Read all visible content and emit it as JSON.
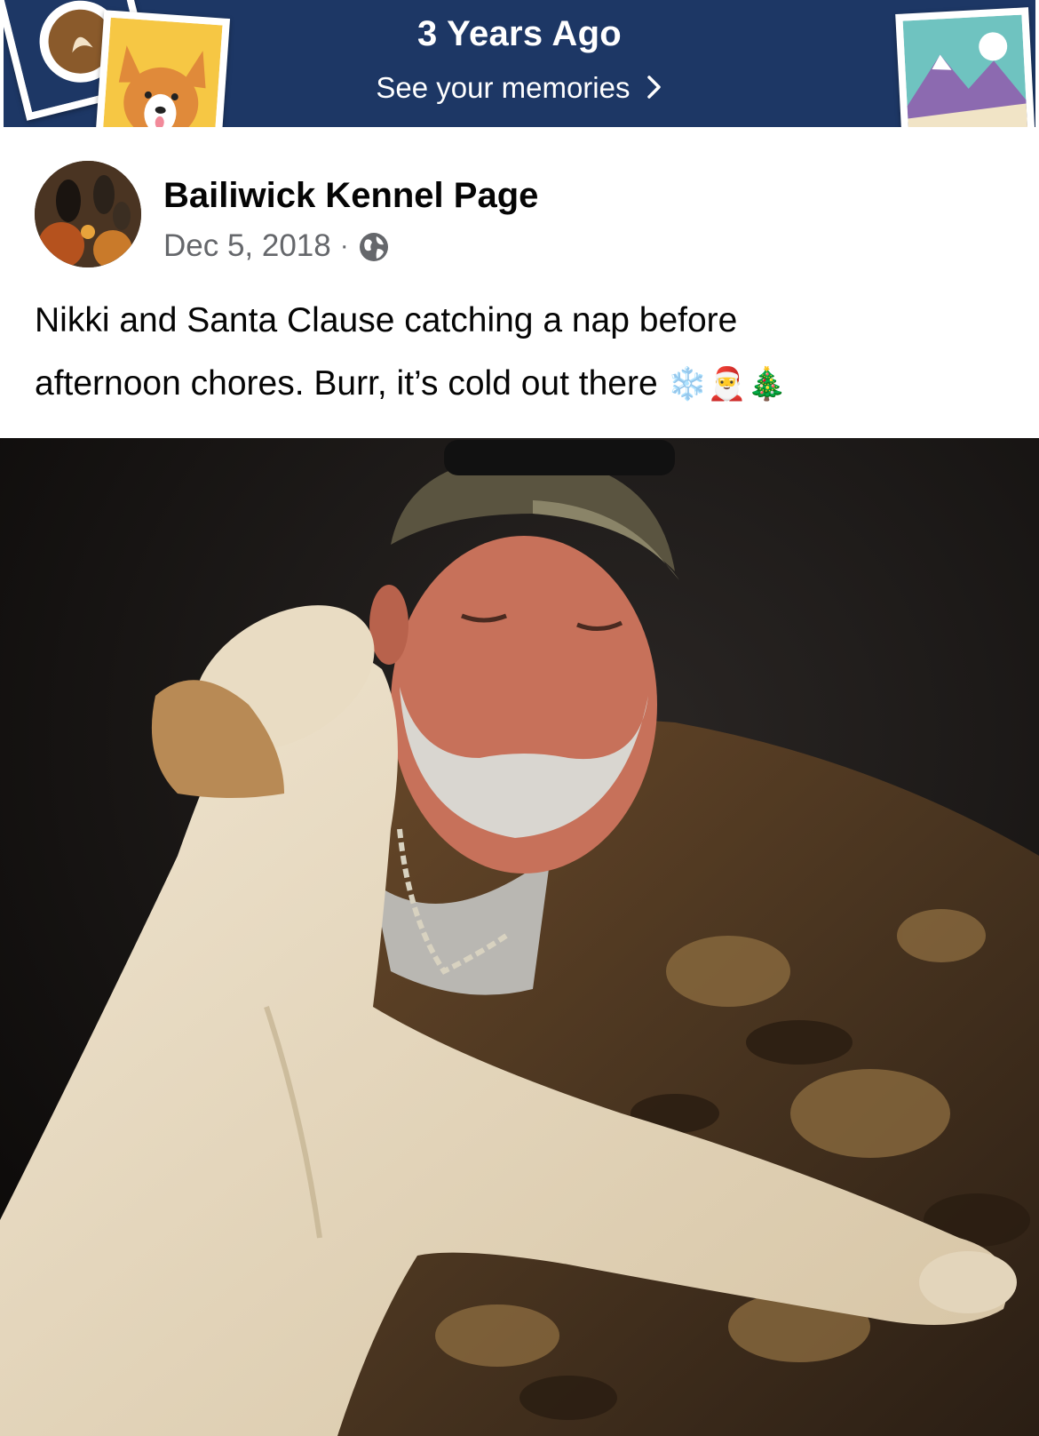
{
  "memories_banner": {
    "title": "3 Years Ago",
    "link_label": "See your memories",
    "chevron_icon": "chevron-right-icon",
    "background_color": "#1d3765"
  },
  "post": {
    "page_name": "Bailiwick Kennel Page",
    "date": "Dec 5, 2018",
    "separator": "·",
    "privacy_icon": "globe-icon",
    "text_line1": "Nikki and Santa Clause catching a nap before",
    "text_line2": "afternoon chores.  Burr, it’s cold out there",
    "emojis": [
      "❄️",
      "🎅",
      "🎄"
    ]
  },
  "photo": {
    "subject": "photo-of-man-and-dog"
  }
}
